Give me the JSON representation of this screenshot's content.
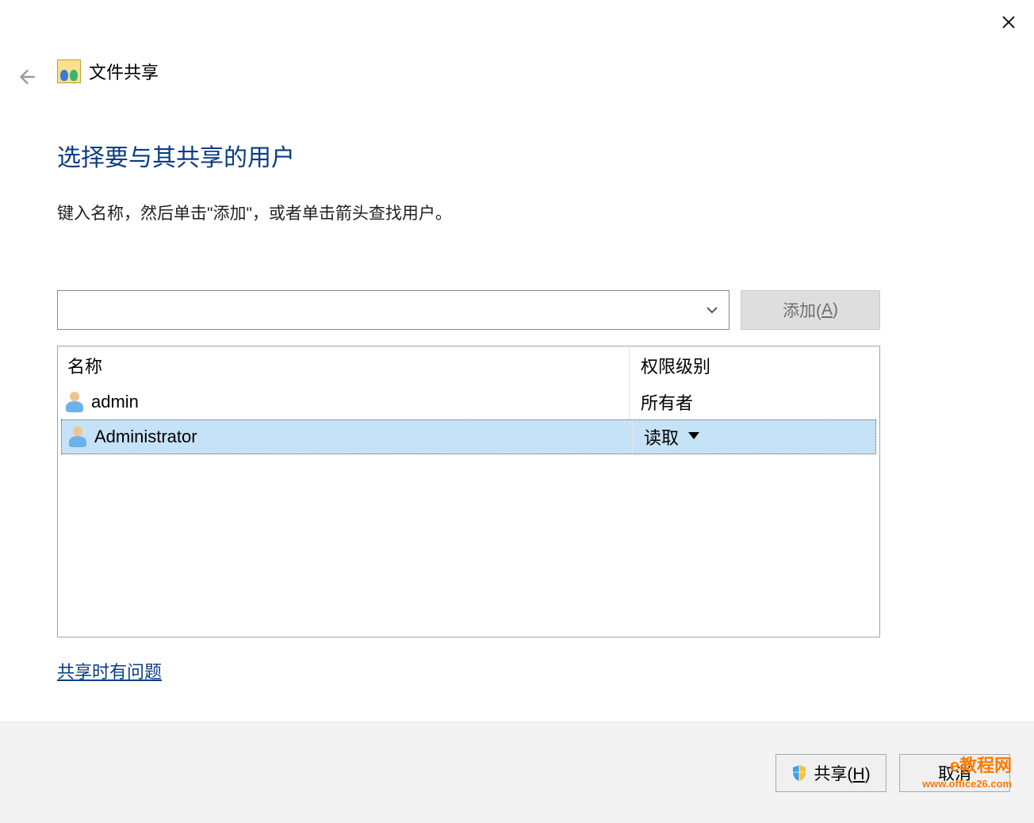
{
  "titlebar": {
    "close_label": "Close"
  },
  "header": {
    "back_label": "Back",
    "title": "文件共享"
  },
  "main": {
    "heading": "选择要与其共享的用户",
    "instruction": "键入名称，然后单击\"添加\"，或者单击箭头查找用户。"
  },
  "input": {
    "value": "",
    "add_label_prefix": "添加(",
    "add_label_key": "A",
    "add_label_suffix": ")"
  },
  "list": {
    "columns": {
      "name": "名称",
      "permission": "权限级别"
    },
    "rows": [
      {
        "name": "admin",
        "permission": "所有者",
        "selected": false,
        "has_dropdown": false
      },
      {
        "name": "Administrator",
        "permission": "读取",
        "selected": true,
        "has_dropdown": true
      }
    ]
  },
  "help_link": "共享时有问题",
  "footer": {
    "share_prefix": "共享(",
    "share_key": "H",
    "share_suffix": ")",
    "cancel": "取消"
  },
  "watermark": {
    "text": "e教程网",
    "sub": "www.office26.com"
  }
}
